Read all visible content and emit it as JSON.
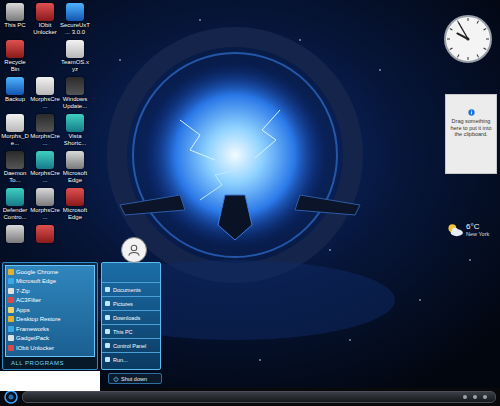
{
  "desktop": {
    "columns": [
      [
        {
          "kind": "icon",
          "label": "This PC"
        },
        {
          "kind": "icon",
          "label": "Recycle Bin"
        },
        {
          "kind": "icon",
          "label": "Backup"
        },
        {
          "kind": "icon",
          "label": "Morphs_De..."
        },
        {
          "kind": "icon",
          "label": "Daemon To..."
        },
        {
          "kind": "icon",
          "label": "Defender Contro..."
        },
        {
          "kind": "unlabeled"
        }
      ],
      [
        {
          "kind": "icon",
          "label": "IObit Unlocker"
        },
        {
          "kind": "blank"
        },
        {
          "kind": "icon",
          "label": "MorphsCre..."
        },
        {
          "kind": "icon",
          "label": "MorphsCre..."
        },
        {
          "kind": "icon",
          "label": "MorphsCre..."
        },
        {
          "kind": "icon",
          "label": "MorphsCre..."
        },
        {
          "kind": "unlabeled"
        }
      ],
      [
        {
          "kind": "icon",
          "label": "SecureUxT... 3.0.0"
        },
        {
          "kind": "icon",
          "label": "TeamOS.xyz"
        },
        {
          "kind": "icon",
          "label": "Windows Update..."
        },
        {
          "kind": "icon",
          "label": "Vista Shortc..."
        },
        {
          "kind": "icon",
          "label": "Microsoft Edge"
        },
        {
          "kind": "icon",
          "label": "Microsoft Edge"
        }
      ]
    ]
  },
  "widgets": {
    "clock": {
      "hour": 9,
      "minute": 55
    },
    "clipboard": {
      "message": "Drag something here to put it into the clipboard."
    },
    "weather": {
      "temperature": "6°C",
      "city": "New York"
    }
  },
  "start_menu": {
    "programs": [
      "Google Chrome",
      "Microsoft Edge",
      "7-Zip",
      "AC3Filter",
      "Apps",
      "Desktop Restore",
      "Frameworks",
      "GadgetPack",
      "IObit Unlocker"
    ],
    "all_programs": "ALL PROGRAMS",
    "places": [
      "Documents",
      "Pictures",
      "Downloads",
      "This PC",
      "Control Panel",
      "Run..."
    ],
    "power": "Shut down"
  }
}
